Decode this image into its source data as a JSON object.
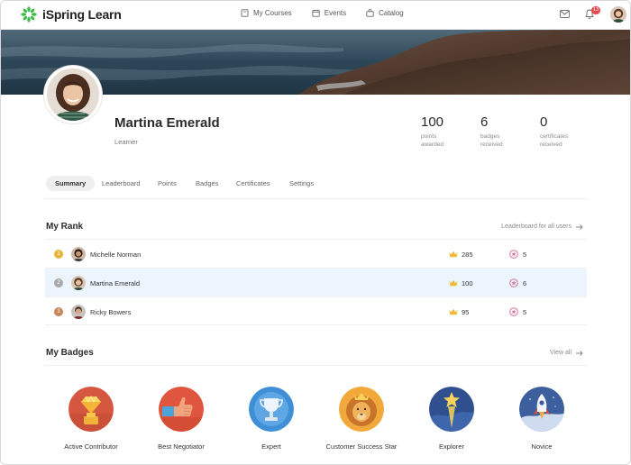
{
  "header": {
    "app_name": "iSpring Learn",
    "nav": [
      {
        "label": "My Courses",
        "icon": "book-icon"
      },
      {
        "label": "Events",
        "icon": "calendar-icon"
      },
      {
        "label": "Catalog",
        "icon": "shop-bag-icon"
      }
    ],
    "notification_count": "13",
    "accent": "#3dbb4a"
  },
  "profile": {
    "name": "Martina Emerald",
    "role": "Learner",
    "stats": [
      {
        "value": "100",
        "label_line1": "points",
        "label_line2": "awarded"
      },
      {
        "value": "6",
        "label_line1": "badges",
        "label_line2": "received"
      },
      {
        "value": "0",
        "label_line1": "certificates",
        "label_line2": "received"
      }
    ]
  },
  "tabs": [
    "Summary",
    "Leaderboard",
    "Points",
    "Badges",
    "Certificates",
    "Settings"
  ],
  "rank": {
    "title": "My Rank",
    "link": "Leaderboard for all users",
    "rows": [
      {
        "position": "1",
        "name": "Michelle Norman",
        "points": "285",
        "badges": "5",
        "color": "#e6b63a"
      },
      {
        "position": "2",
        "name": "Martina Emerald",
        "points": "100",
        "badges": "6",
        "color": "#a9a9a9"
      },
      {
        "position": "3",
        "name": "Ricky Bowers",
        "points": "95",
        "badges": "5",
        "color": "#c8845a"
      }
    ]
  },
  "badges": {
    "title": "My Badges",
    "link": "View all",
    "items": [
      {
        "label": "Active Contributor",
        "icon": "diamond-icon"
      },
      {
        "label": "Best Negotiator",
        "icon": "thumbs-up-icon"
      },
      {
        "label": "Expert",
        "icon": "trophy-icon"
      },
      {
        "label": "Customer Success Star",
        "icon": "lion-icon"
      },
      {
        "label": "Explorer",
        "icon": "star-icon"
      },
      {
        "label": "Novice",
        "icon": "rocket-icon"
      }
    ]
  }
}
